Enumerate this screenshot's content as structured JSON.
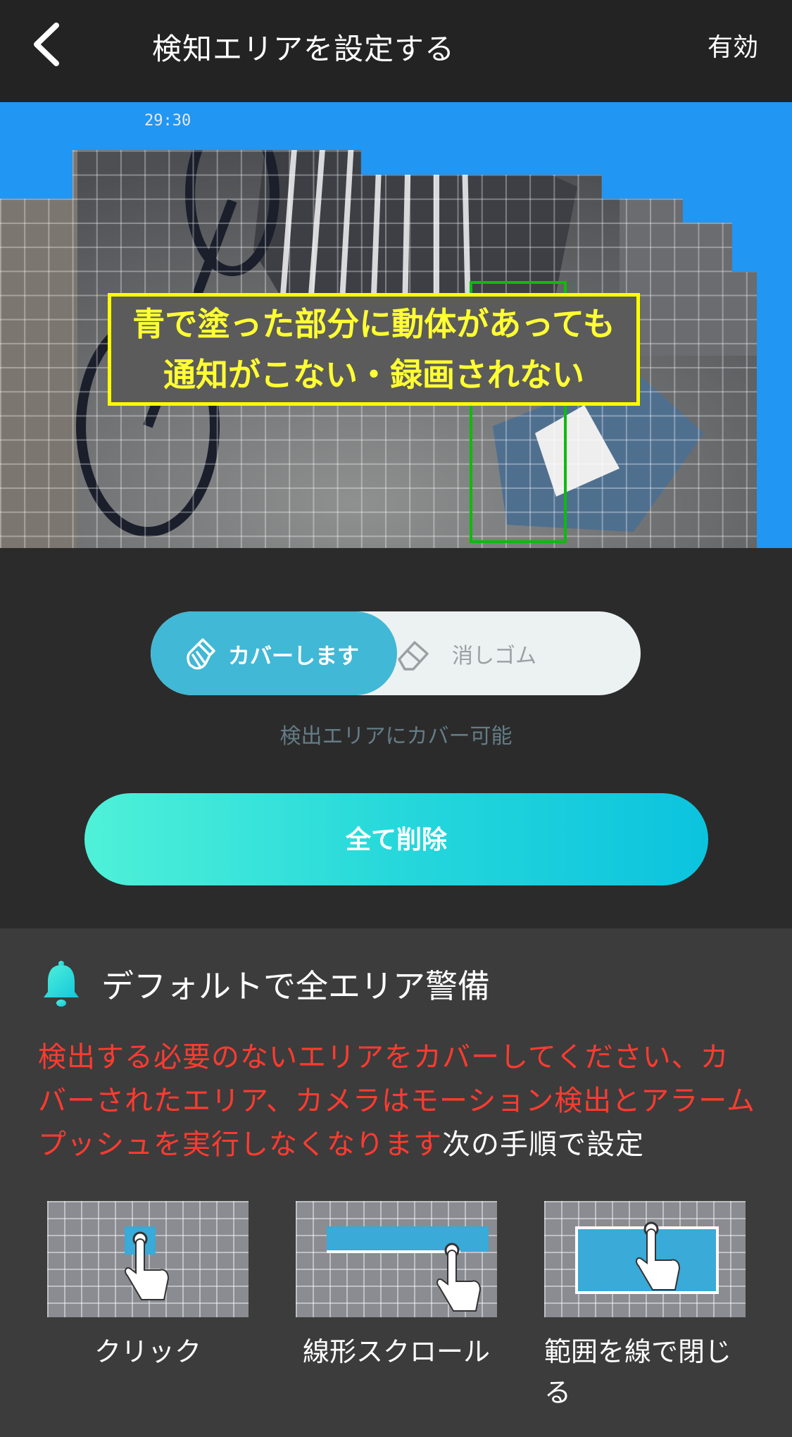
{
  "header": {
    "title": "検知エリアを設定する",
    "enable_label": "有効"
  },
  "preview": {
    "timestamp": "29:30",
    "callout_line1": "青で塗った部分に動体があっても",
    "callout_line2": "通知がこない・録画されない",
    "mask_color": "#2196f3"
  },
  "mode_toggle": {
    "cover_label": "カバーします",
    "eraser_label": "消しゴム",
    "selected": "cover",
    "hint": "検出エリアにカバー可能"
  },
  "delete_all_label": "全て削除",
  "info": {
    "title": "デフォルトで全エリア警備",
    "warning": "検出する必要のないエリアをカバーしてください、カバーされたエリア、カメラはモーション検出とアラームプッシュを実行しなくなります",
    "steps_intro": "次の手順で設定",
    "steps": [
      {
        "label": "クリック"
      },
      {
        "label": "線形スクロール"
      },
      {
        "label": "範囲を線で閉じる"
      }
    ]
  },
  "colors": {
    "accent_blue": "#41b8d5",
    "button_gradient_start": "#4ff1d8",
    "button_gradient_end": "#0cc3de",
    "warning_red": "#ff3b30",
    "callout_yellow": "#ffff33"
  }
}
